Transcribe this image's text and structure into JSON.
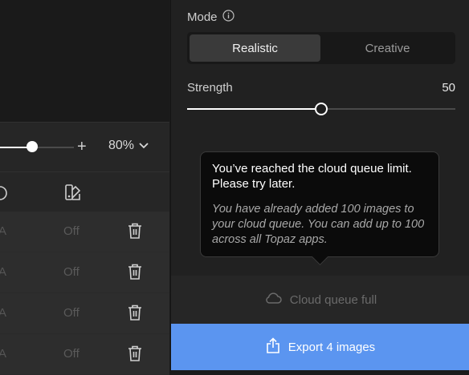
{
  "zoom": {
    "value_label": "80%",
    "plus_label": "+",
    "slider_fraction": 0.44
  },
  "table": {
    "rows": [
      {
        "model_cell": "A",
        "status": "Off"
      },
      {
        "model_cell": "A",
        "status": "Off"
      },
      {
        "model_cell": "A",
        "status": "Off"
      },
      {
        "model_cell": "A",
        "status": "Off"
      }
    ]
  },
  "settings": {
    "mode_label": "Mode",
    "modes": [
      "Realistic",
      "Creative"
    ],
    "selected_mode": "Realistic",
    "strength_label": "Strength",
    "strength_value": "50",
    "strength_fraction": 0.5
  },
  "tooltip": {
    "title": "You’ve reached the cloud queue limit. Please try later.",
    "body": "You have already added 100 images to your cloud queue. You can add up to 100 across all Topaz apps."
  },
  "queue": {
    "label": "Cloud queue full"
  },
  "export": {
    "label": "Export 4 images"
  },
  "colors": {
    "accent": "#5b95f0",
    "panel": "#212121",
    "tooltip_bg": "#0b0b0b"
  }
}
